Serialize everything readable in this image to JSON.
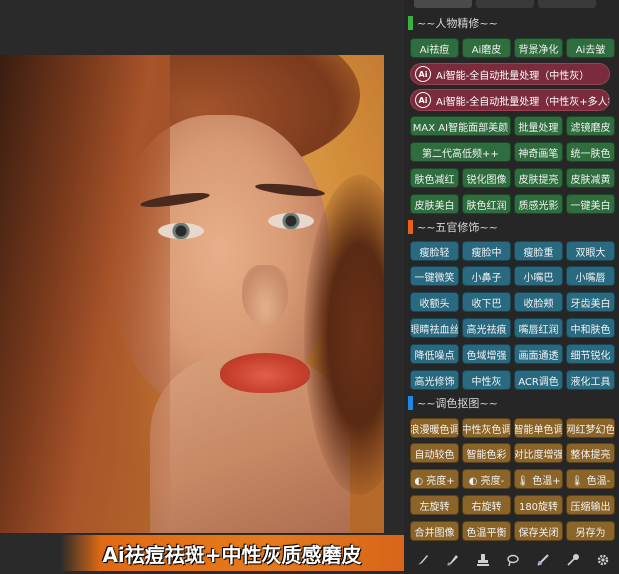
{
  "caption": "Ai祛痘祛斑+中性灰质感磨皮",
  "tabs": [
    "",
    "",
    ""
  ],
  "sections": {
    "portrait": {
      "title": "~~人物精修~~",
      "color": "#3cb043"
    },
    "features": {
      "title": "~~五官修饰~~",
      "color": "#e8621c"
    },
    "grading": {
      "title": "~~调色抠图~~",
      "color": "#1e88e5"
    }
  },
  "portrait": {
    "row1": [
      "Ai祛痘",
      "Ai磨皮",
      "背景净化",
      "Ai去皱"
    ],
    "wide1": "Ai智能-全自动批量处理（中性灰）",
    "wide2": "Ai智能-全自动批量处理（中性灰+多人瘦脸）",
    "ai_badge": "Ai",
    "rows": [
      [
        "MAX AI智能面部美颜",
        "批量处理",
        "滤镜磨皮"
      ],
      [
        "第二代高低频++",
        "神奇画笔",
        "统一肤色"
      ],
      [
        "肤色减红",
        "锐化图像",
        "皮肤提亮",
        "皮肤减黄"
      ],
      [
        "皮肤美白",
        "肤色红润",
        "质感光影",
        "一键美白"
      ]
    ]
  },
  "features": {
    "rows": [
      [
        "瘦脸轻",
        "瘦脸中",
        "瘦脸重",
        "双眼大"
      ],
      [
        "一键微笑",
        "小鼻子",
        "小嘴巴",
        "小嘴唇"
      ],
      [
        "收额头",
        "收下巴",
        "收脸颊",
        "牙齿美白"
      ],
      [
        "眼睛祛血丝",
        "高光祛痕",
        "嘴唇红润",
        "中和肤色"
      ],
      [
        "降低噪点",
        "色域增强",
        "画面通透",
        "细节锐化"
      ],
      [
        "高光修饰",
        "中性灰",
        "ACR调色",
        "液化工具"
      ]
    ]
  },
  "grading": {
    "rows": [
      [
        "浪漫暖色调",
        "中性灰色调",
        "智能单色调",
        "网红梦幻色"
      ],
      [
        "自动较色",
        "智能色彩",
        "对比度增强",
        "整体提亮"
      ],
      [
        "◐ 亮度+",
        "◐ 亮度-",
        "🌡 色温+",
        "🌡 色温-"
      ],
      [
        "左旋转",
        "右旋转",
        "180旋转",
        "压缩输出"
      ],
      [
        "合并图像",
        "色温平衡",
        "保存关闭",
        "另存为"
      ]
    ]
  },
  "toolbar": [
    "brush-icon",
    "eraser-brush-icon",
    "stamp-icon",
    "lasso-icon",
    "blur-brush-icon",
    "dodge-icon",
    "gear-icon"
  ]
}
